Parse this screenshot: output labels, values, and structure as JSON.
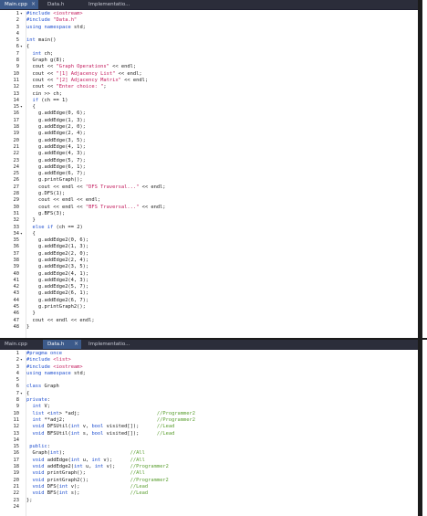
{
  "top_pane": {
    "tabs": [
      {
        "label": "Main.cpp",
        "active": true
      },
      {
        "label": "Data.h",
        "active": false
      },
      {
        "label": "Implementatio...",
        "active": false
      }
    ],
    "fold_lines": [
      1,
      6,
      15,
      34
    ],
    "lines": [
      "#include <iostream>",
      "#include \"Data.h\"",
      "using namespace std;",
      "",
      "int main()",
      "{",
      "  int ch;",
      "  Graph g(8);",
      "  cout << \"Graph Operations\" << endl;",
      "  cout << \"[1] Adjacency List\" << endl;",
      "  cout << \"[2] Adjacency Matrix\" << endl;",
      "  cout << \"Enter choice: \";",
      "  cin >> ch;",
      "  if (ch == 1)",
      "  {",
      "    g.addEdge(0, 6);",
      "    g.addEdge(1, 3);",
      "    g.addEdge(2, 0);",
      "    g.addEdge(2, 4);",
      "    g.addEdge(3, 5);",
      "    g.addEdge(4, 1);",
      "    g.addEdge(4, 3);",
      "    g.addEdge(5, 7);",
      "    g.addEdge(6, 1);",
      "    g.addEdge(6, 7);",
      "    g.printGraph();",
      "    cout << endl << \"DFS Traversal...\" << endl;",
      "    g.DFS(1);",
      "    cout << endl << endl;",
      "    cout << endl << \"BFS Traversal...\" << endl;",
      "    g.BFS(3);",
      "  }",
      "  else if (ch == 2)",
      "  {",
      "    g.addEdge2(0, 6);",
      "    g.addEdge2(1, 3);",
      "    g.addEdge2(2, 0);",
      "    g.addEdge2(2, 4);",
      "    g.addEdge2(3, 5);",
      "    g.addEdge2(4, 1);",
      "    g.addEdge2(4, 3);",
      "    g.addEdge2(5, 7);",
      "    g.addEdge2(6, 1);",
      "    g.addEdge2(6, 7);",
      "    g.printGraph2();",
      "  }",
      "  cout << endl << endl;",
      "}"
    ]
  },
  "bottom_pane": {
    "tabs": [
      {
        "label": "Main.cpp",
        "active": false
      },
      {
        "label": "Data.h",
        "active": true
      },
      {
        "label": "Implementatio...",
        "active": false
      }
    ],
    "fold_lines": [
      2,
      7
    ],
    "lines": [
      "#pragma once",
      "#include <list>",
      "#include <iostream>",
      "using namespace std;",
      "",
      "class Graph",
      "{",
      "private:",
      "  int V;",
      "  list <int> *adj;                          //Programmer2",
      "  int **adj2;                               //Programmer2",
      "  void DFSUtil(int v, bool visited[]);      //Lead",
      "  void BFSUtil(int s, bool visited[]);      //Lead",
      "",
      " public:",
      "  Graph(int);                      //All",
      "  void addEdge(int u, int v);      //All",
      "  void addEdge2(int u, int v);     //Programmer2",
      "  void printGraph();               //All",
      "  void printGraph2();              //Programmer2",
      "  void DFS(int v);                 //Lead",
      "  void BFS(int s);                 //Lead",
      "};",
      ""
    ]
  },
  "colors": {
    "keyword": "#1f4fcf",
    "string": "#c2185b",
    "comment": "#5a9e2f",
    "tabbar": "#2b2d3a",
    "active_tab": "#3c5a8a"
  }
}
